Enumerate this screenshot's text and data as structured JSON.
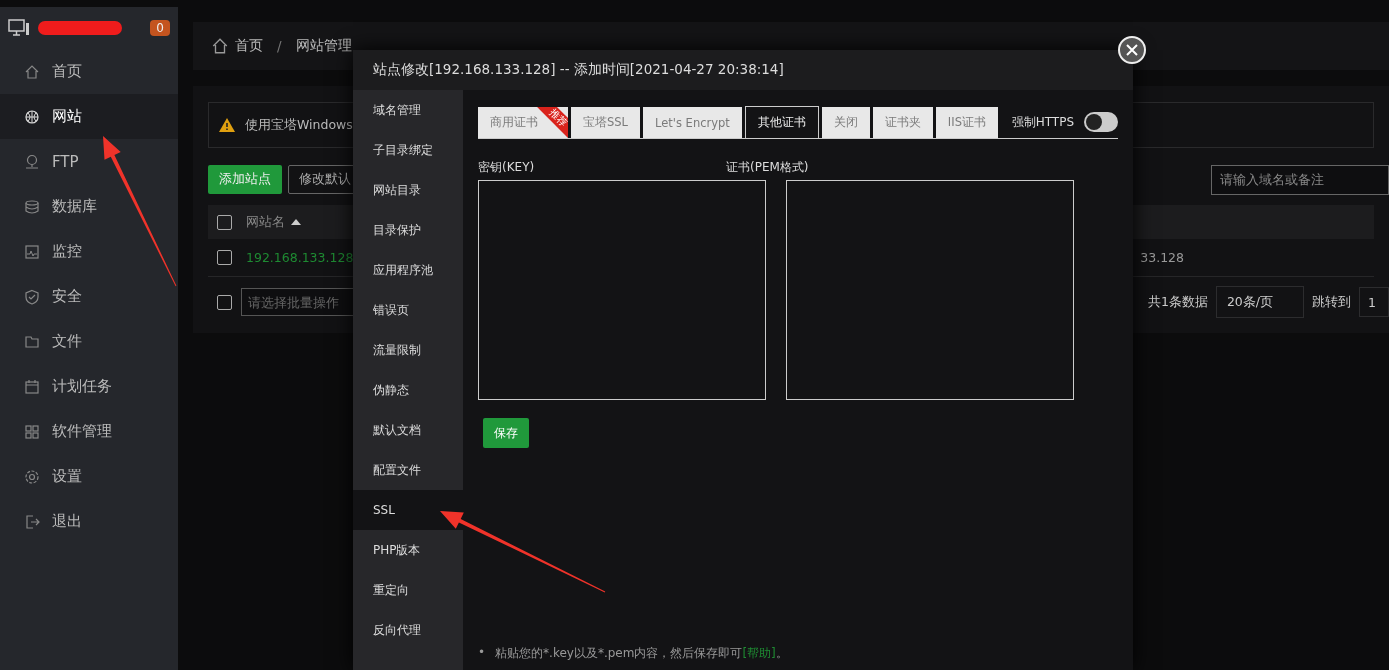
{
  "sidebar": {
    "badge": "0",
    "items": [
      {
        "label": "首页",
        "selected": false
      },
      {
        "label": "网站",
        "selected": true
      },
      {
        "label": "FTP",
        "selected": false
      },
      {
        "label": "数据库",
        "selected": false
      },
      {
        "label": "监控",
        "selected": false
      },
      {
        "label": "安全",
        "selected": false
      },
      {
        "label": "文件",
        "selected": false
      },
      {
        "label": "计划任务",
        "selected": false
      },
      {
        "label": "软件管理",
        "selected": false
      },
      {
        "label": "设置",
        "selected": false
      },
      {
        "label": "退出",
        "selected": false
      }
    ]
  },
  "breadcrumb": [
    "首页",
    "网站管理"
  ],
  "breadcrumb_separator": "/",
  "notice": "使用宝塔Windows",
  "toolbar": {
    "buttons": [
      "添加站点",
      "修改默认"
    ],
    "search": {
      "placeholder": "请输入域名或备注"
    }
  },
  "table": {
    "header": {
      "checked": false,
      "column_1": "网站名"
    },
    "rows": [
      {
        "checked": false,
        "name": "192.168.133.128",
        "column_2": "33.128"
      }
    ]
  },
  "footer": {
    "checked": false,
    "batch_placeholder": "请选择批量操作",
    "total": "共1条数据",
    "page_size": "20条/页",
    "jump_label": "跳转到",
    "jump_value": "1"
  },
  "dialog": {
    "title": "站点修改[192.168.133.128] -- 添加时间[2021-04-27 20:38:14]",
    "menu": [
      {
        "label": "域名管理",
        "selected": false
      },
      {
        "label": "子目录绑定",
        "selected": false
      },
      {
        "label": "网站目录",
        "selected": false
      },
      {
        "label": "目录保护",
        "selected": false
      },
      {
        "label": "应用程序池",
        "selected": false
      },
      {
        "label": "错误页",
        "selected": false
      },
      {
        "label": "流量限制",
        "selected": false
      },
      {
        "label": "伪静态",
        "selected": false
      },
      {
        "label": "默认文档",
        "selected": false
      },
      {
        "label": "配置文件",
        "selected": false
      },
      {
        "label": "SSL",
        "selected": true
      },
      {
        "label": "PHP版本",
        "selected": false
      },
      {
        "label": "重定向",
        "selected": false
      },
      {
        "label": "反向代理",
        "selected": false
      }
    ],
    "tabs": [
      {
        "label": "商用证书",
        "selected": false,
        "badge": "推荐"
      },
      {
        "label": "宝塔SSL",
        "selected": false
      },
      {
        "label": "Let's Encrypt",
        "selected": false
      },
      {
        "label": "其他证书",
        "selected": true
      },
      {
        "label": "关闭",
        "selected": false
      },
      {
        "label": "证书夹",
        "selected": false
      },
      {
        "label": "IIS证书",
        "selected": false
      }
    ],
    "force_https": {
      "label": "强制HTTPS",
      "on": false
    },
    "key_label": "密钥(KEY)",
    "cert_label": "证书(PEM格式)",
    "save": "保存",
    "note_bullet": "•",
    "note": "粘贴您的*.key以及*.pem内容，然后保存即可",
    "note_link": "[帮助]",
    "note_end": "。"
  }
}
